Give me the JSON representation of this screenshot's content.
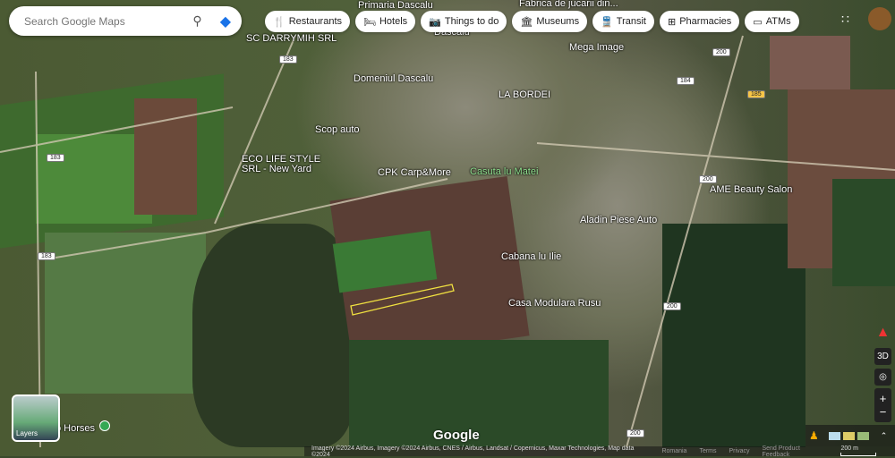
{
  "search": {
    "placeholder": "Search Google Maps",
    "search_icon": "magnifier",
    "directions_icon": "diamond-arrow"
  },
  "chips": [
    {
      "label": "Restaurants",
      "icon": "🍴"
    },
    {
      "label": "Hotels",
      "icon": "🛏"
    },
    {
      "label": "Things to do",
      "icon": "📷"
    },
    {
      "label": "Museums",
      "icon": "🏛"
    },
    {
      "label": "Transit",
      "icon": "🚆"
    },
    {
      "label": "Pharmacies",
      "icon": "⊞"
    },
    {
      "label": "ATMs",
      "icon": "▭"
    }
  ],
  "places": [
    "Primaria Dascalu",
    "Fabrica de jucarii din...",
    "Dascalu",
    "SC DARRYMIH SRL",
    "Mega Image",
    "Domeniul Dascalu",
    "LA BORDEI",
    "Scop auto",
    "ECO LIFE STYLE",
    "SRL - New Yard",
    "CPK Carp&More",
    "Casuta lu Matei",
    "AME Beauty Salon",
    "Aladin Piese Auto",
    "Cabana lu Ilie",
    "Casa Modulara Rusu",
    "o Horses"
  ],
  "roads": [
    "183",
    "183",
    "183",
    "200",
    "184",
    "185",
    "200",
    "200",
    "200"
  ],
  "controls": {
    "three_d": "3D",
    "zoom_in": "+",
    "zoom_out": "−"
  },
  "layers_label": "Layers",
  "logo": "Google",
  "footer": {
    "attribution": "Imagery ©2024 Airbus, Imagery ©2024 Airbus, CNES / Airbus, Landsat / Copernicus, Maxar Technologies, Map data ©2024",
    "country": "Romania",
    "terms": "Terms",
    "privacy": "Privacy",
    "feedback": "Send Product Feedback",
    "scale": "200 m"
  }
}
